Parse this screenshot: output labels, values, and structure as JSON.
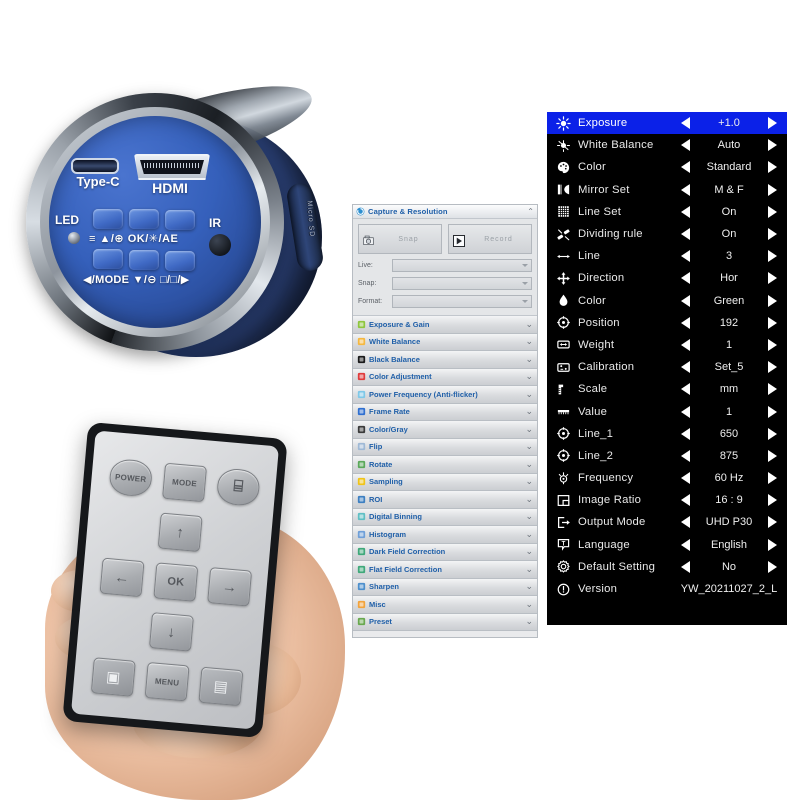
{
  "camera": {
    "port_typec": "Type-C",
    "port_hdmi": "HDMI",
    "label_led": "LED",
    "label_ir": "IR",
    "label_sd": "Micro SD",
    "key_menu": "≡",
    "key_up": "▲/⊕",
    "key_ok": "OK/✳/AE",
    "key_mode": "◀/MODE",
    "key_down": "▼/⊖",
    "key_capture": "☐/☐/▶",
    "keyrow_top_text": "≡      ▲/⊕  OK/✳/AE",
    "keyrow_bottom_text": "◀/MODE  ▼/⊖  □/□/▶"
  },
  "remote": {
    "buttons": [
      {
        "name": "power-button",
        "label": "POWER",
        "shape": "round"
      },
      {
        "name": "mode-button",
        "label": "MODE",
        "shape": "square"
      },
      {
        "name": "grid-button",
        "label": "⌸",
        "shape": "round"
      },
      {
        "name": "up-button",
        "label": "↑",
        "shape": "square"
      },
      {
        "name": "left-button",
        "label": "←",
        "shape": "square"
      },
      {
        "name": "ok-button",
        "label": "OK",
        "shape": "square"
      },
      {
        "name": "right-button",
        "label": "→",
        "shape": "square"
      },
      {
        "name": "down-button",
        "label": "↓",
        "shape": "square"
      },
      {
        "name": "photo-button",
        "label": "▣",
        "shape": "square"
      },
      {
        "name": "menu-button",
        "label": "MENU",
        "shape": "square"
      },
      {
        "name": "video-button",
        "label": "▤",
        "shape": "square"
      }
    ]
  },
  "software_panel": {
    "header": {
      "title": "Capture & Resolution",
      "collapse_glyph": "⌃"
    },
    "capture": {
      "snap_button": "Snap",
      "record_button": "Record",
      "fields": [
        {
          "label": "Live:",
          "value": "",
          "placeholder": ""
        },
        {
          "label": "Snap:",
          "value": "",
          "placeholder": ""
        },
        {
          "label": "Format:",
          "value": "",
          "placeholder": ""
        }
      ]
    },
    "sections": [
      {
        "label": "Exposure & Gain",
        "icon": "exposure-icon",
        "color": "#8ec63f"
      },
      {
        "label": "White Balance",
        "icon": "white-balance-icon",
        "color": "#f5b841"
      },
      {
        "label": "Black Balance",
        "icon": "black-balance-icon",
        "color": "#1a1a1a"
      },
      {
        "label": "Color Adjustment",
        "icon": "color-adjust-icon",
        "color": "#e03c3c"
      },
      {
        "label": "Power Frequency (Anti-flicker)",
        "icon": "bulb-icon",
        "color": "#7fc8e8"
      },
      {
        "label": "Frame Rate",
        "icon": "lightning-icon",
        "color": "#2f6fd0"
      },
      {
        "label": "Color/Gray",
        "icon": "color-gray-icon",
        "color": "#3a3a3a"
      },
      {
        "label": "Flip",
        "icon": "flip-icon",
        "color": "#9fb9d6"
      },
      {
        "label": "Rotate",
        "icon": "rotate-icon",
        "color": "#5aa85a"
      },
      {
        "label": "Sampling",
        "icon": "sampling-icon",
        "color": "#f0c419"
      },
      {
        "label": "ROI",
        "icon": "roi-icon",
        "color": "#3d7fc1"
      },
      {
        "label": "Digital Binning",
        "icon": "binning-icon",
        "color": "#5fbfc4"
      },
      {
        "label": "Histogram",
        "icon": "histogram-icon",
        "color": "#6f9fd8"
      },
      {
        "label": "Dark Field Correction",
        "icon": "dark-field-icon",
        "color": "#3fa87a"
      },
      {
        "label": "Flat Field Correction",
        "icon": "flat-field-icon",
        "color": "#3fa87a"
      },
      {
        "label": "Sharpen",
        "icon": "sharpen-icon",
        "color": "#4d8fcc"
      },
      {
        "label": "Misc",
        "icon": "misc-icon",
        "color": "#f2a33c"
      },
      {
        "label": "Preset",
        "icon": "preset-icon",
        "color": "#69a84f"
      }
    ],
    "collapse_glyph": "⌄"
  },
  "osd_menu": {
    "rows": [
      {
        "icon": "brightness-sun-icon",
        "label": "Exposure",
        "value": "+1.0",
        "selected": true,
        "arrows": true
      },
      {
        "icon": "white-balance-icon",
        "label": "White Balance",
        "value": "Auto",
        "selected": false,
        "arrows": true
      },
      {
        "icon": "palette-icon",
        "label": "Color",
        "value": "Standard",
        "selected": false,
        "arrows": true
      },
      {
        "icon": "mirror-icon",
        "label": "Mirror Set",
        "value": "M & F",
        "selected": false,
        "arrows": true
      },
      {
        "icon": "grid-icon",
        "label": "Line Set",
        "value": "On",
        "selected": false,
        "arrows": true
      },
      {
        "icon": "dividing-rule-icon",
        "label": "Dividing rule",
        "value": "On",
        "selected": false,
        "arrows": true
      },
      {
        "icon": "line-arrow-icon",
        "label": "Line",
        "value": "3",
        "selected": false,
        "arrows": true
      },
      {
        "icon": "direction-move-icon",
        "label": "Direction",
        "value": "Hor",
        "selected": false,
        "arrows": true
      },
      {
        "icon": "droplet-icon",
        "label": "Color",
        "value": "Green",
        "selected": false,
        "arrows": true
      },
      {
        "icon": "crosshair-icon",
        "label": "Position",
        "value": "192",
        "selected": false,
        "arrows": true
      },
      {
        "icon": "weight-icon",
        "label": "Weight",
        "value": "1",
        "selected": false,
        "arrows": true
      },
      {
        "icon": "calibration-icon",
        "label": "Calibration",
        "value": "Set_5",
        "selected": false,
        "arrows": true
      },
      {
        "icon": "scale-ruler-icon",
        "label": "Scale",
        "value": "mm",
        "selected": false,
        "arrows": true
      },
      {
        "icon": "value-ruler-icon",
        "label": "Value",
        "value": "1",
        "selected": false,
        "arrows": true
      },
      {
        "icon": "crosshair-icon",
        "label": "Line_1",
        "value": "650",
        "selected": false,
        "arrows": true
      },
      {
        "icon": "crosshair-icon",
        "label": "Line_2",
        "value": "875",
        "selected": false,
        "arrows": true
      },
      {
        "icon": "frequency-icon",
        "label": "Frequency",
        "value": "60 Hz",
        "selected": false,
        "arrows": true
      },
      {
        "icon": "image-ratio-icon",
        "label": "Image Ratio",
        "value": "16 : 9",
        "selected": false,
        "arrows": true
      },
      {
        "icon": "output-mode-icon",
        "label": "Output Mode",
        "value": "UHD P30",
        "selected": false,
        "arrows": true
      },
      {
        "icon": "language-icon",
        "label": "Language",
        "value": "English",
        "selected": false,
        "arrows": true
      },
      {
        "icon": "gear-icon",
        "label": "Default Setting",
        "value": "No",
        "selected": false,
        "arrows": true
      },
      {
        "icon": "info-icon",
        "label": "Version",
        "value": "YW_20211027_2_L",
        "selected": false,
        "arrows": false
      }
    ],
    "highlight_color": "#0b21e8",
    "background_color": "#000000"
  }
}
